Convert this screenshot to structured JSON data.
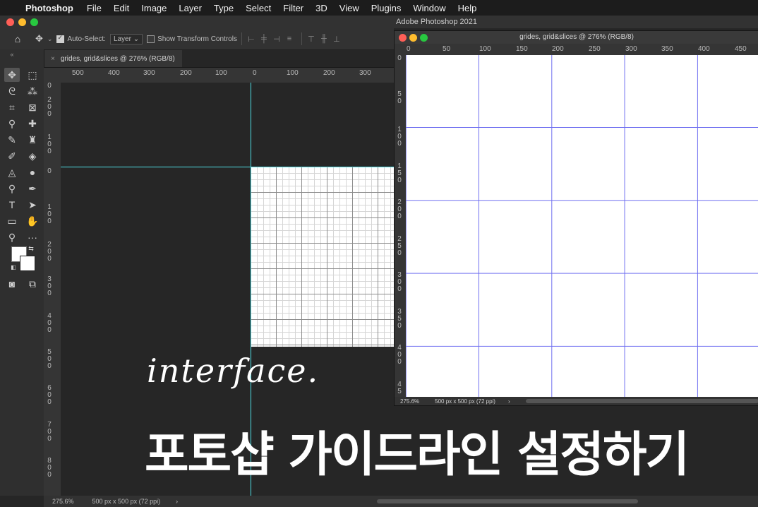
{
  "menubar": {
    "apple": "",
    "app_name": "Photoshop",
    "items": [
      "File",
      "Edit",
      "Image",
      "Layer",
      "Type",
      "Select",
      "Filter",
      "3D",
      "View",
      "Plugins",
      "Window",
      "Help"
    ]
  },
  "app_title": "Adobe Photoshop 2021",
  "options_bar": {
    "auto_select_label": "Auto-Select:",
    "auto_select_value": "Layer",
    "show_transform_label": "Show Transform Controls"
  },
  "document_tab": {
    "title": "grides, grid&slices @ 276% (RGB/8)"
  },
  "main_ruler": {
    "horizontal_labels": [
      "500",
      "400",
      "300",
      "200",
      "100",
      "0",
      "100",
      "200",
      "300"
    ],
    "vertical_labels": [
      "0",
      "2\n0\n0",
      "1\n0\n0",
      "0",
      "1\n0\n0",
      "2\n0\n0",
      "3\n0\n0",
      "4\n0\n0",
      "5\n0\n0",
      "6\n0\n0",
      "7\n0\n0",
      "8\n0\n0"
    ]
  },
  "status": {
    "zoom": "275.6%",
    "doc_size": "500 px x 500 px (72 ppi)",
    "arrow": "›"
  },
  "window2": {
    "title": "grides, grid&slices @ 276% (RGB/8)",
    "ruler_horizontal": [
      "0",
      "50",
      "100",
      "150",
      "200",
      "250",
      "300",
      "350",
      "400",
      "450"
    ],
    "ruler_vertical": [
      "0",
      "5\n0",
      "1\n0\n0",
      "1\n5\n0",
      "2\n0\n0",
      "2\n5\n0",
      "3\n0\n0",
      "3\n5\n0",
      "4\n0\n0",
      "4\n5"
    ],
    "zoom": "275.6%",
    "doc_size": "500 px x 500 px (72 ppi)",
    "arrow": "›"
  },
  "overlay": {
    "script_text": "interface.",
    "headline": "포토샵 가이드라인 설정하기"
  },
  "colors": {
    "guide": "#4fe0e6",
    "grid_blue": "#6f6ff0",
    "traffic_red": "#ff5f57",
    "traffic_yellow": "#febc2e",
    "traffic_green": "#28c840"
  }
}
